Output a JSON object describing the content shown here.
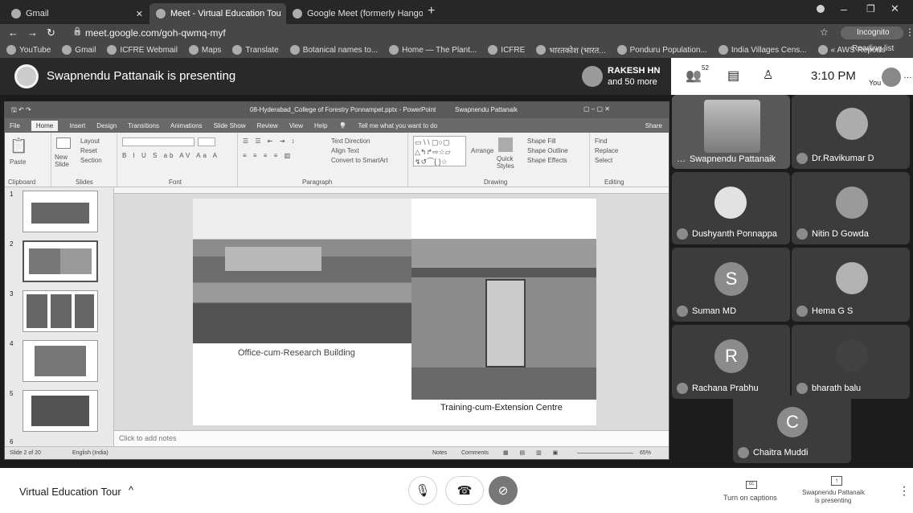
{
  "browser": {
    "tabs": [
      {
        "title": "Gmail",
        "active": false
      },
      {
        "title": "Meet - Virtual Education Tou",
        "active": true
      },
      {
        "title": "Google Meet (formerly Hangout",
        "active": false
      }
    ],
    "new_tab": "+",
    "url": "meet.google.com/goh-qwmq-myf",
    "incognito": "Incognito",
    "bookmarks": [
      "YouTube",
      "Gmail",
      "ICFRE Webmail",
      "Maps",
      "Translate",
      "Botanical names to...",
      "Home — The Plant...",
      "ICFRE",
      "भारतकोश (भारत...",
      "Ponduru Population...",
      "India Villages Cens...",
      "« AWS Reports"
    ],
    "reading_list": "Reading list"
  },
  "meet": {
    "presenter_banner": "Swapnendu Pattanaik is presenting",
    "others_line1": "RAKESH HN",
    "others_line2": "and 50 more",
    "people_count": "52",
    "time": "3:10 PM",
    "you_label": "You",
    "participants": [
      {
        "name": "Swapnendu Pattanaik",
        "initial": ""
      },
      {
        "name": "Dr.Ravikumar D",
        "initial": ""
      },
      {
        "name": "Dushyanth Ponnappa",
        "initial": ""
      },
      {
        "name": "Nitin D Gowda",
        "initial": ""
      },
      {
        "name": "Suman MD",
        "initial": "S"
      },
      {
        "name": "Hema G S",
        "initial": ""
      },
      {
        "name": "Rachana Prabhu",
        "initial": "R"
      },
      {
        "name": "bharath balu",
        "initial": ""
      },
      {
        "name": "Chaitra Muddi",
        "initial": "C"
      }
    ],
    "meeting_title": "Virtual Education Tour",
    "captions_label": "Turn on captions",
    "presenting_label_line1": "Swapnendu Pattanaik",
    "presenting_label_line2": "is presenting"
  },
  "ppt": {
    "window_title": "08-Hyderabad_College of Forestry Ponnampet.pptx - PowerPoint",
    "user": "Swapnendu Pattanaik",
    "share": "Share",
    "tabs": [
      "File",
      "Home",
      "Insert",
      "Design",
      "Transitions",
      "Animations",
      "Slide Show",
      "Review",
      "View",
      "Help"
    ],
    "tell_me": "Tell me what you want to do",
    "groups": {
      "clipboard": "Clipboard",
      "slides": "Slides",
      "font": "Font",
      "paragraph": "Paragraph",
      "drawing": "Drawing",
      "editing": "Editing"
    },
    "buttons": {
      "paste": "Paste",
      "new_slide": "New Slide",
      "layout": "Layout",
      "reset": "Reset",
      "section": "Section",
      "find": "Find",
      "replace": "Replace",
      "select": "Select",
      "arrange": "Arrange",
      "quick_styles": "Quick Styles",
      "shape_fill": "Shape Fill",
      "shape_outline": "Shape Outline",
      "shape_effects": "Shape Effects",
      "text_direction": "Text Direction",
      "align_text": "Align Text",
      "smartart": "Convert to SmartArt"
    },
    "slide_numbers": [
      "1",
      "2",
      "3",
      "4",
      "5",
      "6"
    ],
    "caption_left": "Office-cum-Research Building",
    "caption_right": "Training-cum-Extension Centre",
    "notes_placeholder": "Click to add notes",
    "status_slide": "Slide 2 of 20",
    "status_lang": "English (India)",
    "status_notes": "Notes",
    "status_comments": "Comments",
    "zoom": "65%"
  }
}
